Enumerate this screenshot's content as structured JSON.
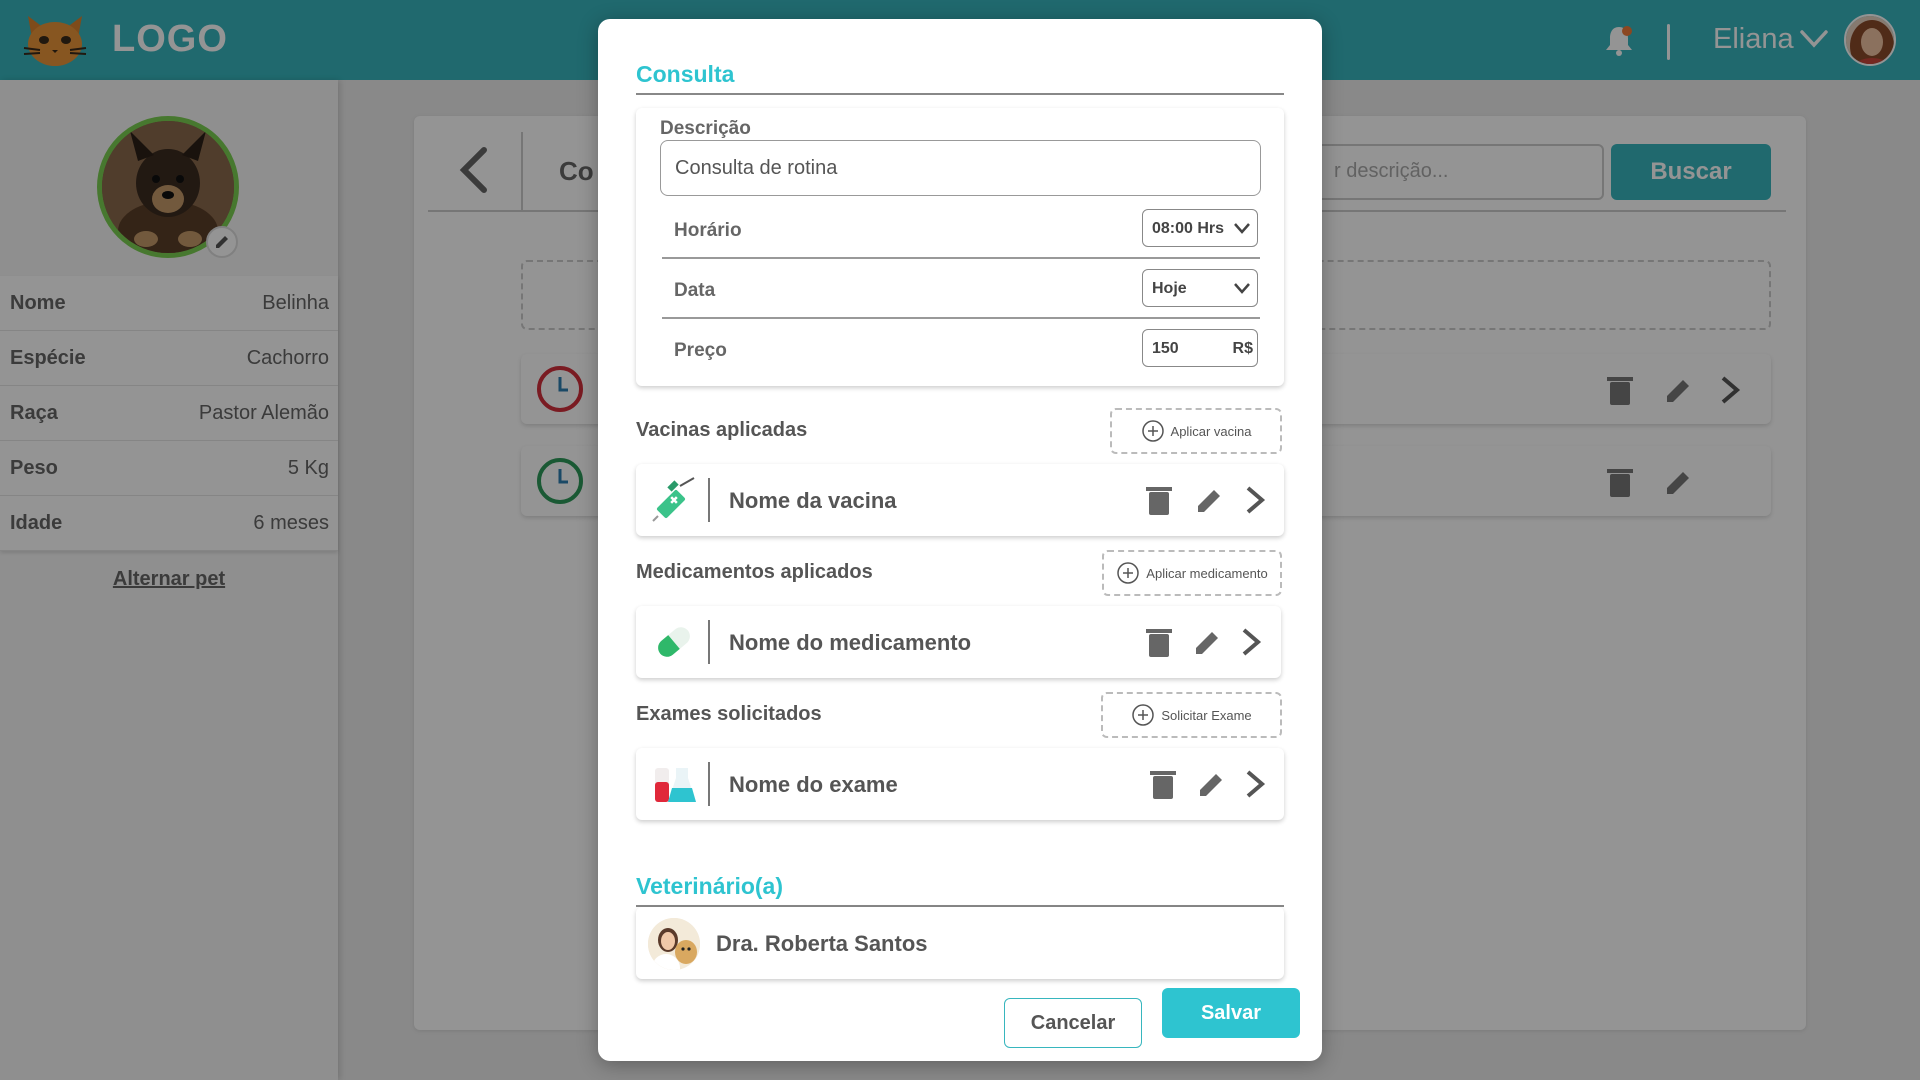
{
  "header": {
    "logo_text": "LOGO",
    "logo_icon": "cat-logo-icon",
    "notification_icon": "bell-icon",
    "user_name": "Eliana"
  },
  "sidebar": {
    "pet_fields": [
      {
        "label": "Nome",
        "value": "Belinha"
      },
      {
        "label": "Espécie",
        "value": "Cachorro"
      },
      {
        "label": "Raça",
        "value": "Pastor Alemão"
      },
      {
        "label": "Peso",
        "value": "5 Kg"
      },
      {
        "label": "Idade",
        "value": "6 meses"
      }
    ],
    "switch_pet": "Alternar pet"
  },
  "background": {
    "title": "Co",
    "search_placeholder": "r descrição...",
    "search_button": "Buscar"
  },
  "modal": {
    "title": "Consulta",
    "description_label": "Descrição",
    "description_value": "Consulta de rotina",
    "fields": {
      "time_label": "Horário",
      "time_value": "08:00 Hrs",
      "date_label": "Data",
      "date_value": "Hoje",
      "price_label": "Preço",
      "price_value": "150",
      "price_currency": "R$"
    },
    "vaccines": {
      "label": "Vacinas aplicadas",
      "add_label": "Aplicar vacina",
      "item_name": "Nome da vacina"
    },
    "medications": {
      "label": "Medicamentos aplicados",
      "add_label": "Aplicar medicamento",
      "item_name": "Nome do medicamento"
    },
    "exams": {
      "label": "Exames solicitados",
      "add_label": "Solicitar Exame",
      "item_name": "Nome do exame"
    },
    "vet": {
      "title": "Veterinário(a)",
      "name": "Dra. Roberta Santos"
    },
    "cancel_label": "Cancelar",
    "save_label": "Salvar"
  },
  "colors": {
    "primary": "#37b6be",
    "accent": "#2ec4d0",
    "clock_red": "#d32f3c",
    "clock_green": "#2e9a5a"
  }
}
